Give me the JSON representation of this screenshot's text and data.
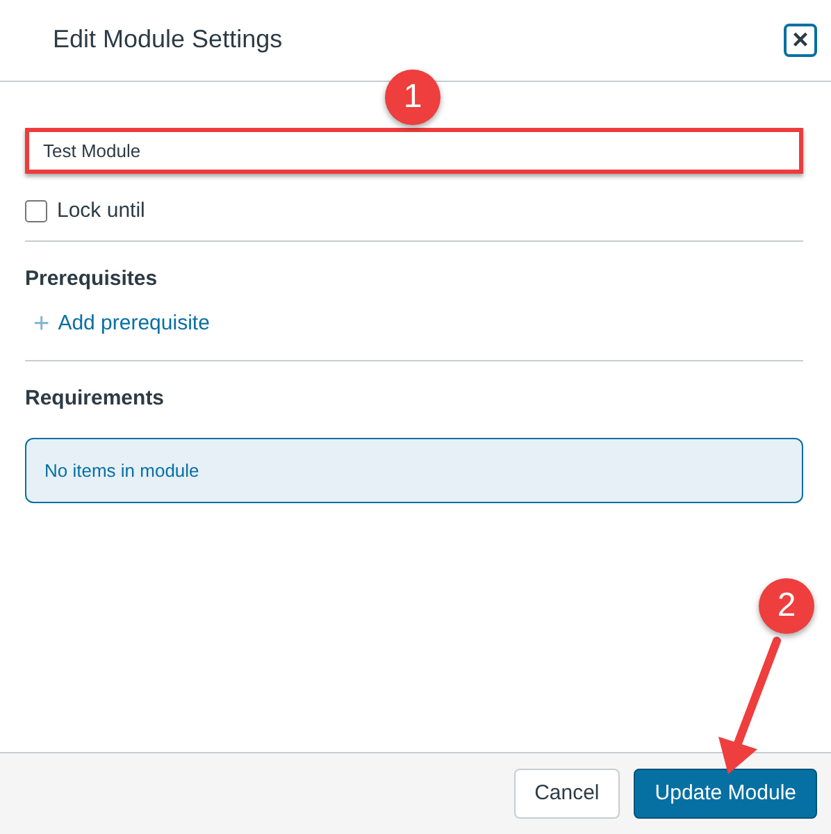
{
  "dialog": {
    "title": "Edit Module Settings",
    "close_label": "×"
  },
  "name_field": {
    "value": "Test Module"
  },
  "lock_until": {
    "label": "Lock until",
    "checked": false
  },
  "prerequisites": {
    "heading": "Prerequisites",
    "add_icon": "+",
    "add_label": "Add prerequisite"
  },
  "requirements": {
    "heading": "Requirements",
    "message": "No items in module"
  },
  "buttons": [
    {
      "label": "Cancel",
      "kind": "secondary"
    },
    {
      "label": "Update Module",
      "kind": "primary"
    }
  ],
  "annotations": [
    {
      "label": "1",
      "kind": "callout"
    },
    {
      "label": "2",
      "kind": "callout"
    }
  ]
}
